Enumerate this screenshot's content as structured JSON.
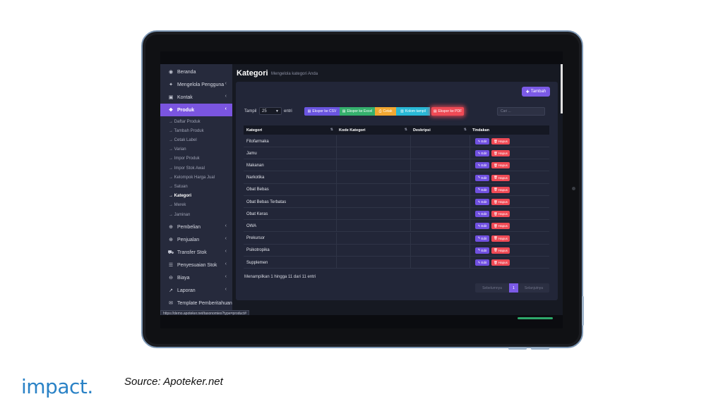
{
  "brand": {
    "logo_text": "impact.",
    "logo_color": "#2a82c6"
  },
  "source": "Source: Apoteker.net",
  "status_url": "https://demo.apoteker.net/taxonomies?type=product#",
  "sidebar": {
    "items": [
      {
        "label": "Beranda",
        "icon": "dashboard-icon",
        "glyph": "◉",
        "has_chevron": false
      },
      {
        "label": "Mengelola Pengguna",
        "icon": "users-icon",
        "glyph": "✦",
        "has_chevron": true
      },
      {
        "label": "Kontak",
        "icon": "contact-book-icon",
        "glyph": "▣",
        "has_chevron": true
      },
      {
        "label": "Produk",
        "icon": "cubes-icon",
        "glyph": "❖",
        "has_chevron": true,
        "active": true
      },
      {
        "label": "Pembelian",
        "icon": "arrow-circle-icon",
        "glyph": "⊕",
        "has_chevron": true
      },
      {
        "label": "Penjualan",
        "icon": "arrow-circle-up-icon",
        "glyph": "⊕",
        "has_chevron": true
      },
      {
        "label": "Transfer Stok",
        "icon": "truck-icon",
        "glyph": "⛟",
        "has_chevron": true
      },
      {
        "label": "Penyesuaian Stok",
        "icon": "database-icon",
        "glyph": "☰",
        "has_chevron": true
      },
      {
        "label": "Biaya",
        "icon": "minus-circle-icon",
        "glyph": "⊖",
        "has_chevron": true
      },
      {
        "label": "Laporan",
        "icon": "chart-line-icon",
        "glyph": "↗",
        "has_chevron": true
      },
      {
        "label": "Template Pemberitahuan",
        "icon": "envelope-icon",
        "glyph": "✉",
        "has_chevron": false
      }
    ],
    "product_sub_items": [
      "→ Daftar Produk",
      "→ Tambah Produk",
      "→ Cetak Label",
      "→ Varian",
      "→ Impor Produk",
      "→ Impor Stok Awal",
      "→ Kelompok Harga Jual",
      "→ Satuan",
      "→ Kategori",
      "→ Merek",
      "→ Jaminan"
    ],
    "current_sub_index": 8,
    "chevron_glyph": "‹"
  },
  "page": {
    "title": "Kategori",
    "subtitle": "Mengelola kategori Anda"
  },
  "toolbar": {
    "add_label": "Tambah",
    "show_label": "Tampil",
    "show_value": "25",
    "entries_label": "entri",
    "export_csv": "Ekspor ke CSV",
    "export_excel": "Ekspor ke Excel",
    "print": "Cetak",
    "columns": "Kolom tampil",
    "export_pdf": "Ekspor ke PDF",
    "search_placeholder": "Cari ..."
  },
  "table": {
    "headers": [
      "Kategori",
      "Kode Kategori",
      "Deskripsi",
      "Tindakan"
    ],
    "rows": [
      "Fitofarmaka",
      "Jamu",
      "Makanan",
      "Narkotika",
      "Obat Bebas",
      "Obat Bebas Terbatas",
      "Obat Keras",
      "OWA",
      "Prekursor",
      "Psikotropika",
      "Supplemen"
    ],
    "edit_label": "Edit",
    "delete_label": "Hapus"
  },
  "footer": {
    "info": "Menampilkan 1 hingga 11 dari 11 entri",
    "prev": "Sebelumnya",
    "page": "1",
    "next": "Selanjutnya"
  },
  "colors": {
    "accent": "#7b5ae6",
    "danger": "#ef4a55",
    "success": "#35b06d",
    "warning": "#f2a731",
    "info": "#29b8d6",
    "sidebar_bg": "#262a3c",
    "card_bg": "#222638"
  }
}
